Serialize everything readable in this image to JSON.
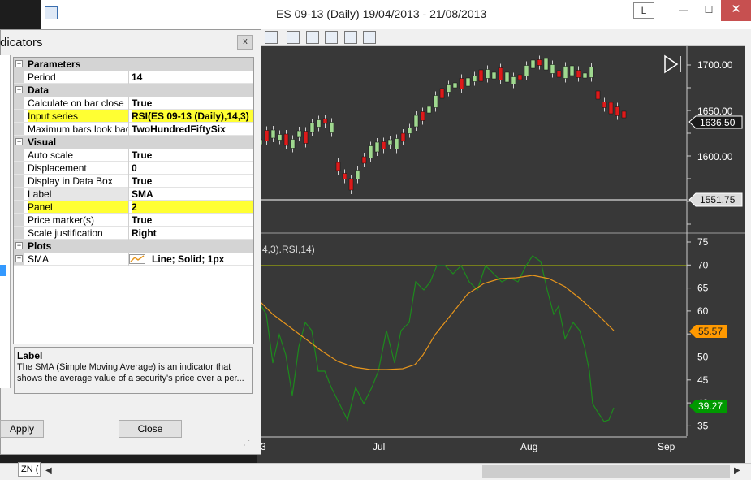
{
  "window": {
    "title": "ES 09-13 (Daily)  19/04/2013 - 21/08/2013",
    "layout_button": "L",
    "minimize": "—",
    "maximize": "☐",
    "close": "✕"
  },
  "dialog": {
    "title": "dicators",
    "close": "x",
    "categories": [
      {
        "label": "Parameters",
        "rows": [
          {
            "name": "Period",
            "value": "14"
          }
        ]
      },
      {
        "label": "Data",
        "rows": [
          {
            "name": "Calculate on bar close",
            "value": "True"
          },
          {
            "name": "Input series",
            "value": "RSI(ES 09-13 (Daily),14,3)"
          },
          {
            "name": "Maximum bars look back",
            "value": "TwoHundredFiftySix"
          }
        ]
      },
      {
        "label": "Visual",
        "rows": [
          {
            "name": "Auto scale",
            "value": "True"
          },
          {
            "name": "Displacement",
            "value": "0"
          },
          {
            "name": "Display in Data Box",
            "value": "True"
          },
          {
            "name": "Label",
            "value": "SMA"
          },
          {
            "name": "Panel",
            "value": "2"
          },
          {
            "name": "Price marker(s)",
            "value": "True"
          },
          {
            "name": "Scale justification",
            "value": "Right"
          }
        ]
      },
      {
        "label": "Plots",
        "rows": [
          {
            "name": "SMA",
            "value": "Line; Solid; 1px"
          }
        ]
      }
    ],
    "description_title": "Label",
    "description": "The SMA (Simple Moving Average) is an indicator that shows the average value of a security's price over a per...",
    "apply": "Apply",
    "close_button": "Close"
  },
  "chart": {
    "price_axis": [
      "1700.00",
      "1650.00",
      "1600.00"
    ],
    "price_markers": [
      "1636.50",
      "1551.75"
    ],
    "indicator_label": "4,3).RSI,14)",
    "rsi_axis": [
      "75",
      "70",
      "65",
      "60",
      "55",
      "50",
      "45",
      "40",
      "35"
    ],
    "rsi_markers": [
      "55.57",
      "39.27"
    ],
    "x_labels": [
      "3",
      "Jul",
      "Aug",
      "Sep"
    ],
    "colors": {
      "background": "#383838",
      "up_candle": "#9fd88f",
      "down_candle": "#dd1a1a",
      "rsi_line": "#1d8a1d",
      "sma_line": "#e6951c",
      "level_line": "#b5c400",
      "sma_marker": "#ff9900",
      "rsi_marker": "#009900"
    }
  },
  "bottom": {
    "tab": "ZN ("
  }
}
